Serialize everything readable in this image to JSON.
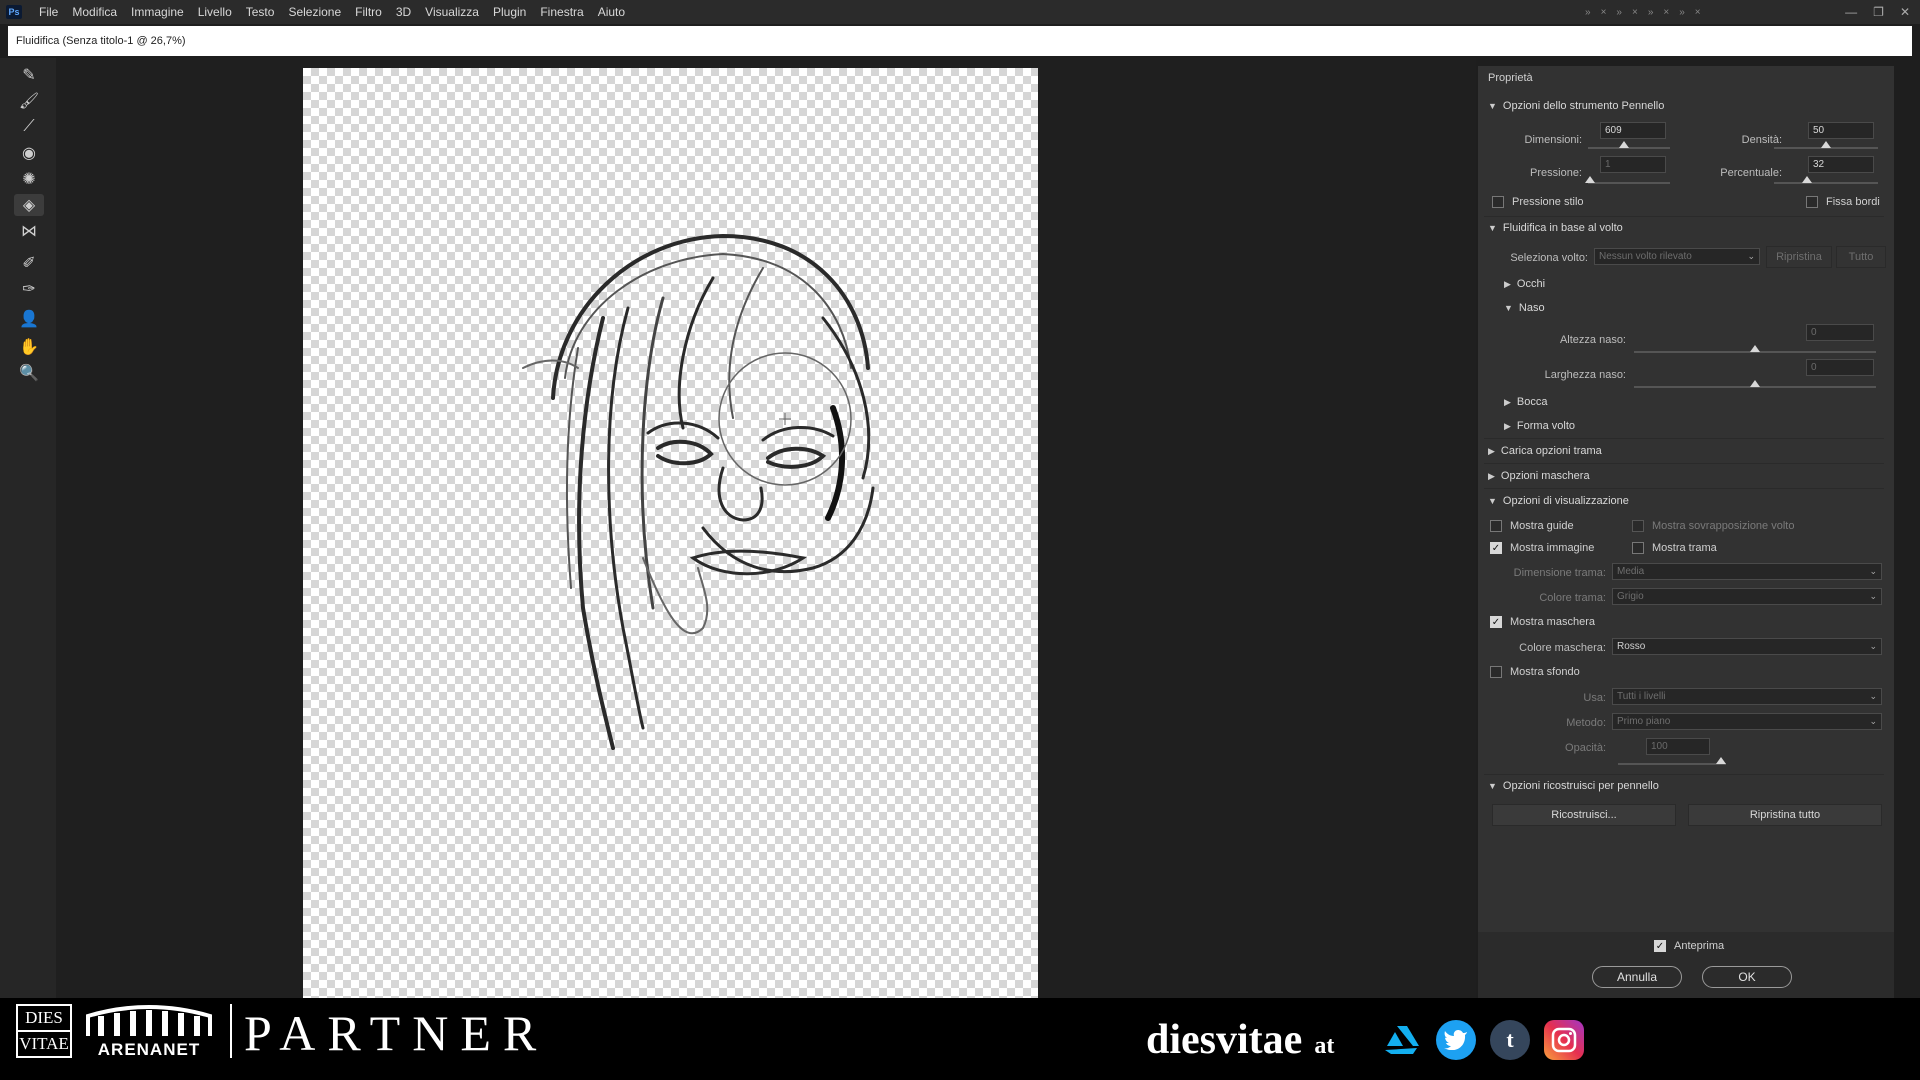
{
  "menubar": {
    "logo": "Ps",
    "items": [
      "File",
      "Modifica",
      "Immagine",
      "Livello",
      "Testo",
      "Selezione",
      "Filtro",
      "3D",
      "Visualizza",
      "Plugin",
      "Finestra",
      "Aiuto"
    ]
  },
  "titlebar": {
    "title": "Fluidifica (Senza titolo-1 @ 26,7%)"
  },
  "panel": {
    "header": "Proprietà",
    "brush": {
      "title": "Opzioni dello strumento Pennello",
      "size_label": "Dimensioni:",
      "size": "609",
      "density_label": "Densità:",
      "density": "50",
      "pressure_label": "Pressione:",
      "pressure": "1",
      "rate_label": "Percentuale:",
      "rate": "32",
      "stylus": "Pressione stilo",
      "pin": "Fissa bordi"
    },
    "face": {
      "title": "Fluidifica in base al volto",
      "select_label": "Seleziona volto:",
      "select_value": "Nessun volto rilevato",
      "reset": "Ripristina",
      "all": "Tutto",
      "eyes": "Occhi",
      "nose": "Naso",
      "nose_height_label": "Altezza naso:",
      "nose_height": "0",
      "nose_width_label": "Larghezza naso:",
      "nose_width": "0",
      "mouth": "Bocca",
      "shape": "Forma volto"
    },
    "load_mesh": "Carica opzioni trama",
    "mask_options": "Opzioni maschera",
    "view": {
      "title": "Opzioni di visualizzazione",
      "show_guides": "Mostra guide",
      "show_face_overlay": "Mostra sovrapposizione volto",
      "show_image": "Mostra immagine",
      "show_mesh": "Mostra trama",
      "mesh_size_label": "Dimensione trama:",
      "mesh_size": "Media",
      "mesh_color_label": "Colore trama:",
      "mesh_color": "Grigio",
      "show_mask": "Mostra maschera",
      "mask_color_label": "Colore maschera:",
      "mask_color": "Rosso",
      "show_backdrop": "Mostra sfondo",
      "use_label": "Usa:",
      "use": "Tutti i livelli",
      "mode_label": "Metodo:",
      "mode": "Primo piano",
      "opacity_label": "Opacità:",
      "opacity": "100"
    },
    "reconstruct": {
      "title": "Opzioni ricostruisci per pennello",
      "reconstruct_btn": "Ricostruisci...",
      "restore_all": "Ripristina tutto"
    }
  },
  "bottom": {
    "preview": "Anteprima",
    "cancel": "Annulla",
    "ok": "OK"
  },
  "banner": {
    "dies_top": "DIES",
    "dies_bottom": "VITAE",
    "arenanet": "ARENANET",
    "partner": "PARTNER",
    "handle": "diesvitae",
    "at": "at"
  },
  "colors": {
    "accent": "#d8d8d8",
    "twitter": "#1da1f2",
    "tumblr": "#35465c",
    "artstation": "#13aff0"
  }
}
